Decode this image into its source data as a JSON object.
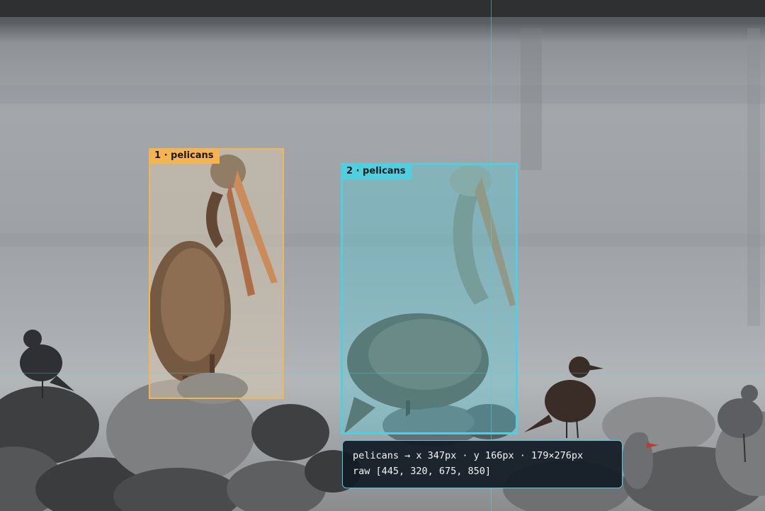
{
  "annotations": [
    {
      "index": "1",
      "label": "1 · pelicans",
      "class": "pelicans",
      "color": "#f5b450"
    },
    {
      "index": "2",
      "label": "2 · pelicans",
      "class": "pelicans",
      "color": "#4fd0e0"
    }
  ],
  "tooltip": {
    "line1": "pelicans → x 347px · y 166px · 179×276px",
    "line2": "raw [445, 320, 675, 850]"
  },
  "icons": {
    "scene": "pelican-photo-icon"
  }
}
